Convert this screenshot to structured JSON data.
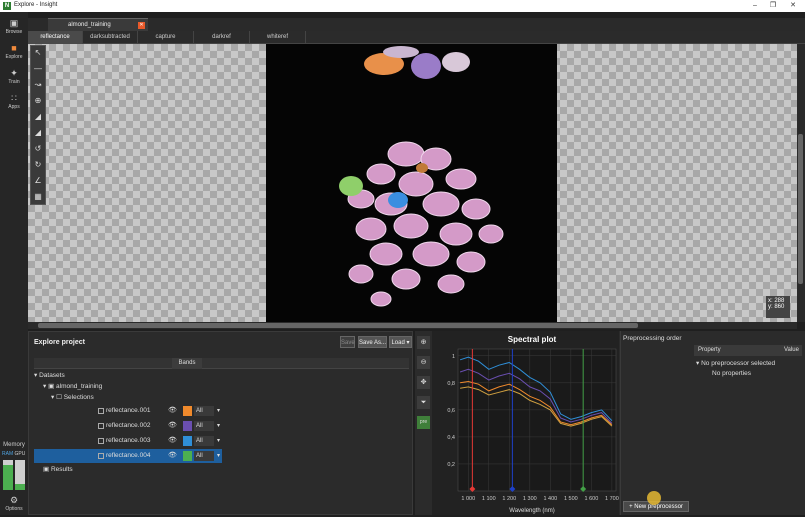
{
  "window": {
    "title": "Explore - Insight",
    "controls": [
      "minimize",
      "maximize",
      "close"
    ]
  },
  "sidebar": {
    "items": [
      {
        "label": "Browse",
        "icon": "folder-icon"
      },
      {
        "label": "Explore",
        "icon": "explore-icon",
        "active": true
      },
      {
        "label": "Train",
        "icon": "train-icon"
      },
      {
        "label": "Apps",
        "icon": "apps-grid-icon"
      }
    ],
    "memory": {
      "label": "Memory",
      "ram_label": "RAM",
      "gpu_label": "GPU",
      "ram_level": 0.85,
      "gpu_level": 0.2
    },
    "options_label": "Options"
  },
  "doc_tab": {
    "label": "almond_training"
  },
  "subtabs": [
    "reflectance",
    "darksubtracted",
    "capture",
    "darkref",
    "whiteref"
  ],
  "viewer": {
    "coords": {
      "x": "x: 288",
      "y": "y: 860"
    }
  },
  "project": {
    "title": "Explore project",
    "buttons": {
      "save": "Save",
      "save_as": "Save As...",
      "load": "Load"
    },
    "columns": {
      "bands": "Bands"
    },
    "tree": {
      "datasets": "Datasets",
      "project": "almond_training",
      "selections": "Selections",
      "results": "Results"
    },
    "selections": [
      {
        "label": "reflectance.001",
        "color": "#f08a2c",
        "bands": "All"
      },
      {
        "label": "reflectance.002",
        "color": "#6a4fb0",
        "bands": "All"
      },
      {
        "label": "reflectance.003",
        "color": "#2f8fd8",
        "bands": "All"
      },
      {
        "label": "reflectance.004",
        "color": "#4caf50",
        "bands": "All",
        "selected": true
      }
    ]
  },
  "spectral": {
    "tools": [
      "zoom-in-icon",
      "zoom-out-icon",
      "pan-icon",
      "filter-icon"
    ],
    "pre_label": "pre"
  },
  "chart_data": {
    "type": "line",
    "title": "Spectral plot",
    "xlabel": "Wavelength (nm)",
    "ylabel": "",
    "xlim": [
      950,
      1720
    ],
    "ylim": [
      0,
      1.05
    ],
    "xticks": [
      1000,
      1100,
      1200,
      1300,
      1400,
      1500,
      1600,
      1700
    ],
    "xtick_labels": [
      "1 000",
      "1 100",
      "1 200",
      "1 300",
      "1 400",
      "1 500",
      "1 600",
      "1 700"
    ],
    "yticks": [
      0.2,
      0.4,
      0.6,
      0.8,
      1.0
    ],
    "ytick_labels": [
      "0,2",
      "0,4",
      "0,6",
      "0,8",
      "1"
    ],
    "grid": true,
    "markers": [
      {
        "x": 1020,
        "color": "#e53935"
      },
      {
        "x": 1215,
        "color": "#1e40c8"
      },
      {
        "x": 1560,
        "color": "#43a047"
      }
    ],
    "x": [
      960,
      1000,
      1050,
      1100,
      1150,
      1200,
      1250,
      1300,
      1350,
      1400,
      1450,
      1500,
      1550,
      1600,
      1650,
      1700
    ],
    "series": [
      {
        "color": "#2f8fd8",
        "values": [
          0.97,
          0.99,
          0.96,
          0.9,
          0.93,
          0.95,
          0.9,
          0.84,
          0.8,
          0.73,
          0.57,
          0.53,
          0.55,
          0.58,
          0.6,
          0.52
        ]
      },
      {
        "color": "#6a4fb0",
        "values": [
          0.88,
          0.9,
          0.87,
          0.82,
          0.85,
          0.87,
          0.83,
          0.77,
          0.74,
          0.68,
          0.54,
          0.51,
          0.53,
          0.56,
          0.58,
          0.5
        ]
      },
      {
        "color": "#f08a2c",
        "values": [
          0.8,
          0.81,
          0.79,
          0.74,
          0.77,
          0.79,
          0.75,
          0.7,
          0.67,
          0.62,
          0.51,
          0.49,
          0.51,
          0.54,
          0.56,
          0.49
        ]
      },
      {
        "color": "#d0a040",
        "values": [
          0.76,
          0.77,
          0.75,
          0.71,
          0.73,
          0.75,
          0.72,
          0.67,
          0.64,
          0.6,
          0.5,
          0.48,
          0.5,
          0.53,
          0.55,
          0.48
        ]
      }
    ]
  },
  "preprocessing": {
    "title": "Preprocessing order",
    "new_button": "+ New preprocessor"
  },
  "properties": {
    "col_property": "Property",
    "col_value": "Value",
    "no_selection": "No preprocessor selected",
    "no_props": "No properties"
  }
}
